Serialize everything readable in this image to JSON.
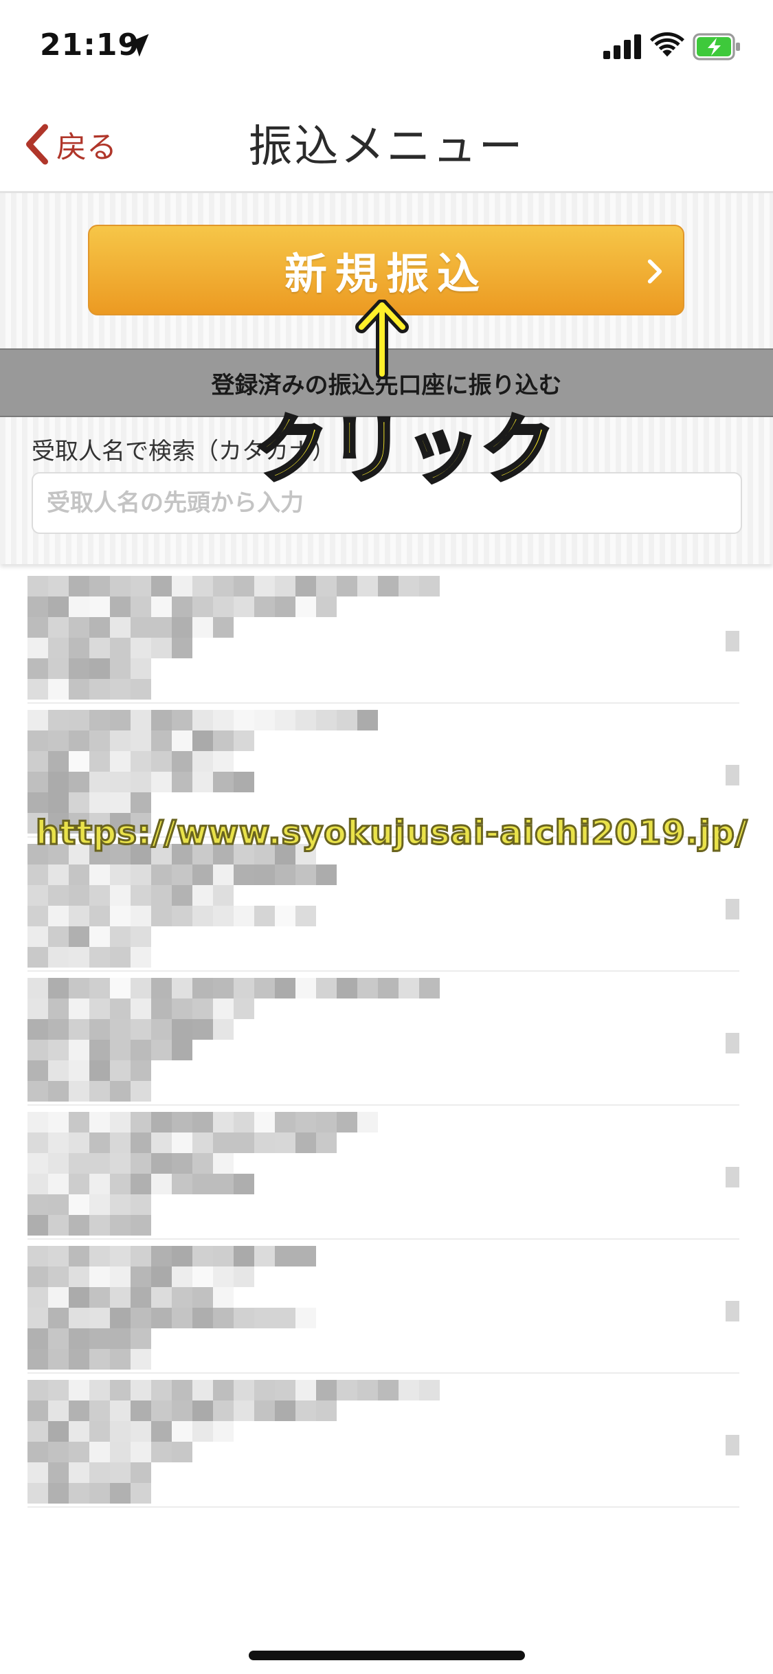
{
  "status_bar": {
    "time": "21:19"
  },
  "nav": {
    "back_label": "戻る",
    "title": "振込メニュー"
  },
  "panel": {
    "new_transfer_label": "新規振込",
    "registered_label": "登録済みの振込先口座に振り込む",
    "search_label": "受取人名で検索（カタカナ）",
    "search_placeholder": "受取人名の先頭から入力",
    "search_value": ""
  },
  "overlay": {
    "click_label": "クリック",
    "url_watermark": "https://www.syokujusai-aichi2019.jp/"
  },
  "colors": {
    "accent_back": "#b0362a",
    "button_top": "#f6c648",
    "button_bottom": "#ec9a22",
    "registered_bar": "#999999",
    "annotation_yellow": "#ffef2a",
    "battery_green": "#3ec93b"
  },
  "icons": {
    "location": "location-arrow-icon",
    "signal": "cellular-signal-icon",
    "wifi": "wifi-icon",
    "battery": "battery-charging-icon",
    "back": "chevron-left-icon",
    "forward": "chevron-right-icon",
    "arrow": "arrow-up-icon"
  },
  "payee_list": {
    "item_count": 7,
    "content": "pixelated"
  }
}
